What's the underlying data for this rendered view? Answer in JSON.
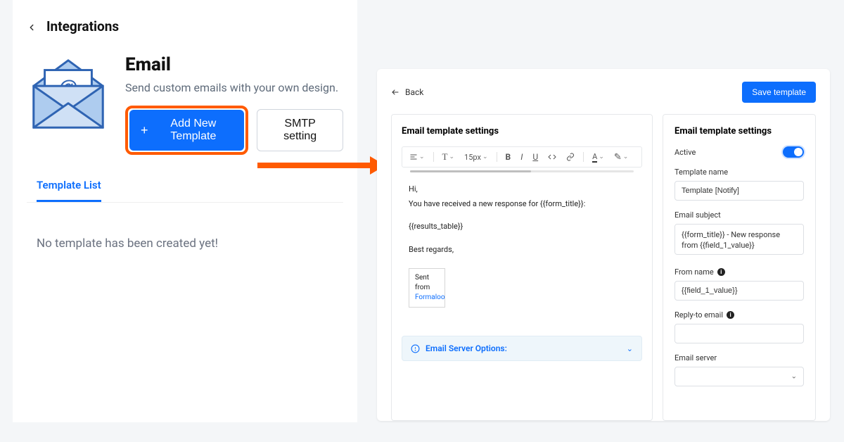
{
  "left": {
    "page_title": "Integrations",
    "hero": {
      "title": "Email",
      "subtitle": "Send custom emails with your own design.",
      "add_btn": "Add New Template",
      "smtp_btn": "SMTP setting"
    },
    "tab_label": "Template List",
    "empty_text": "No template has been created yet!"
  },
  "right": {
    "back_label": "Back",
    "save_label": "Save template",
    "left_title": "Email template settings",
    "right_title": "Email template settings",
    "toolbar": {
      "font_size": "15px"
    },
    "editor": {
      "line1": "Hi,",
      "line2": "You have received a new response for {{form_title}}:",
      "line3": "{{results_table}}",
      "line4": "Best regards,",
      "sent_prefix": "Sent from ",
      "sent_link": "Formaloo"
    },
    "server_options_label": "Email Server Options:",
    "form": {
      "active_label": "Active",
      "template_name_label": "Template name",
      "template_name_value": "Template [Notify]",
      "subject_label": "Email subject",
      "subject_value": "{{form_title}} - New response from {{field_1_value}}",
      "from_name_label": "From name",
      "from_name_value": "{{field_1_value}}",
      "reply_to_label": "Reply-to email",
      "reply_to_value": "",
      "server_label": "Email server"
    }
  }
}
